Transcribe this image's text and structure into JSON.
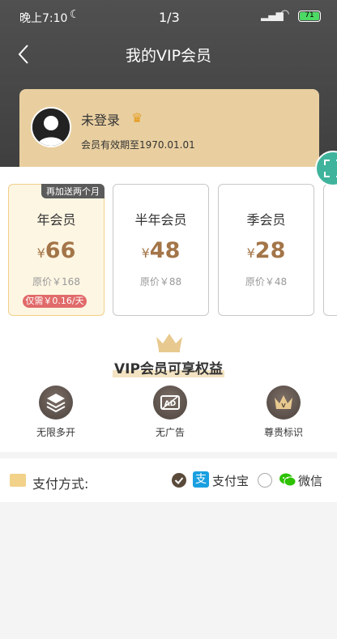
{
  "status": {
    "time": "晚上7:10",
    "page": "1/3",
    "battery": "71"
  },
  "header": {
    "title": "我的VIP会员"
  },
  "user": {
    "name": "未登录",
    "expire": "会员有效期至1970.01.01"
  },
  "plans": [
    {
      "name": "年会员",
      "yen": "¥",
      "price": "66",
      "original": "原价￥168",
      "daily": "仅需￥0.16/天",
      "ribbon": "再加送两个月"
    },
    {
      "name": "半年会员",
      "yen": "¥",
      "price": "48",
      "original": "原价￥88"
    },
    {
      "name": "季会员",
      "yen": "¥",
      "price": "28",
      "original": "原价￥48"
    }
  ],
  "benefits": {
    "title": "VIP会员可享权益",
    "items": [
      {
        "label": "无限多开",
        "icon": "layers-icon"
      },
      {
        "label": "无广告",
        "icon": "no-ad-icon"
      },
      {
        "label": "尊贵标识",
        "icon": "crown-icon"
      }
    ]
  },
  "payment": {
    "label": "支付方式:",
    "options": [
      {
        "name": "支付宝",
        "selected": true
      },
      {
        "name": "微信",
        "selected": false
      }
    ]
  },
  "colors": {
    "header": "#4a4a4a",
    "gold": "#e9cfa0",
    "price": "#a37548",
    "accent_red": "#e16a6a"
  }
}
